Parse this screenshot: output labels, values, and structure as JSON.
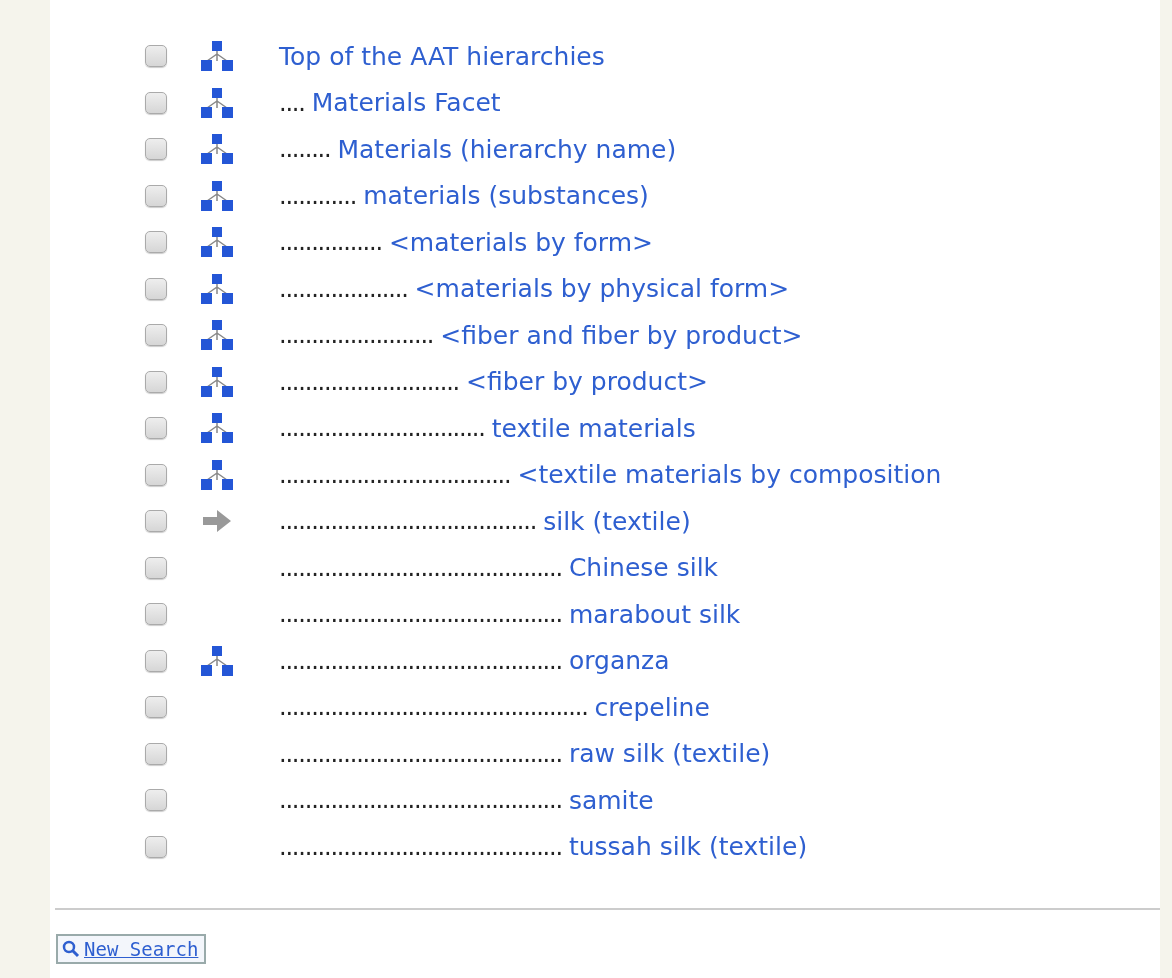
{
  "rows": [
    {
      "checked": false,
      "kind": "hierarchy",
      "prefix": "",
      "label": "Top of the AAT hierarchies"
    },
    {
      "checked": false,
      "kind": "hierarchy",
      "prefix": "....",
      "label": "Materials Facet"
    },
    {
      "checked": false,
      "kind": "hierarchy",
      "prefix": "........",
      "label": "Materials (hierarchy name)"
    },
    {
      "checked": false,
      "kind": "hierarchy",
      "prefix": "............",
      "label": "materials (substances)"
    },
    {
      "checked": false,
      "kind": "hierarchy",
      "prefix": "................",
      "label": "<materials by form>"
    },
    {
      "checked": false,
      "kind": "hierarchy",
      "prefix": "....................",
      "label": "<materials by physical form>"
    },
    {
      "checked": false,
      "kind": "hierarchy",
      "prefix": "........................",
      "label": "<fiber and fiber by product>"
    },
    {
      "checked": false,
      "kind": "hierarchy",
      "prefix": "............................",
      "label": "<fiber by product>"
    },
    {
      "checked": false,
      "kind": "hierarchy",
      "prefix": "................................",
      "label": "textile materials"
    },
    {
      "checked": false,
      "kind": "hierarchy",
      "prefix": "....................................",
      "label": "<textile materials by composition"
    },
    {
      "checked": false,
      "kind": "arrow",
      "prefix": "........................................",
      "label": "silk (textile)"
    },
    {
      "checked": false,
      "kind": "leaf",
      "prefix": "............................................",
      "label": "Chinese silk"
    },
    {
      "checked": false,
      "kind": "leaf",
      "prefix": "............................................",
      "label": "marabout silk"
    },
    {
      "checked": false,
      "kind": "hierarchy",
      "prefix": "............................................",
      "label": "organza"
    },
    {
      "checked": false,
      "kind": "leaf",
      "prefix": "................................................",
      "label": "crepeline"
    },
    {
      "checked": false,
      "kind": "leaf",
      "prefix": "............................................",
      "label": "raw silk (textile)"
    },
    {
      "checked": false,
      "kind": "leaf",
      "prefix": "............................................",
      "label": "samite"
    },
    {
      "checked": false,
      "kind": "leaf",
      "prefix": "............................................",
      "label": "tussah silk (textile)"
    }
  ],
  "button": {
    "label": "New Search"
  }
}
